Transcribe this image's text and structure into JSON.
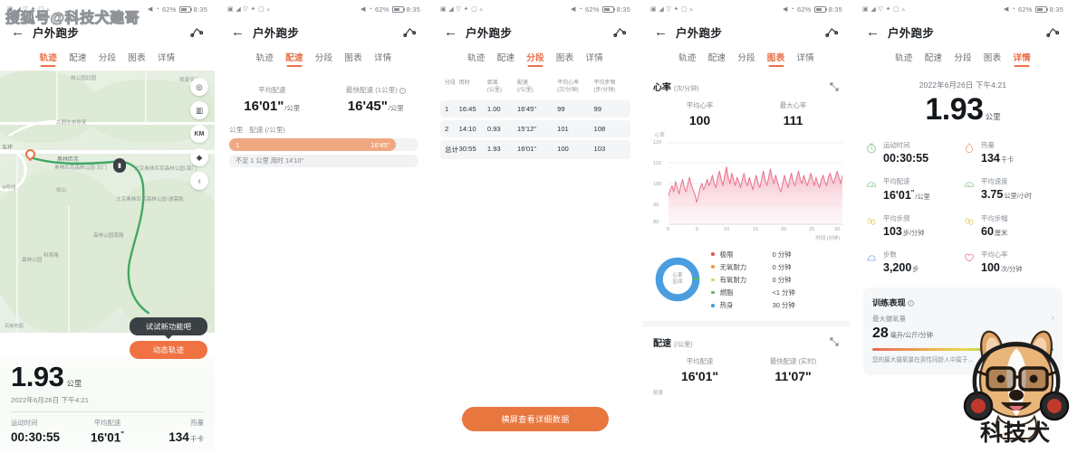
{
  "watermarks": {
    "sohu": "搜狐号@科技犬建哥",
    "mascot_label": "科技犬"
  },
  "status_bar": {
    "battery_percent": "62%",
    "time": "8:35",
    "icons": [
      "sim-icon",
      "signal-icon",
      "wifi-icon",
      "bluetooth-icon",
      "nfc-icon",
      "vpn-icon"
    ],
    "right_icons": [
      "mute-icon",
      "alarm-icon"
    ]
  },
  "nav": {
    "back_icon": "back-arrow-icon",
    "title": "户外跑步",
    "share_icon": "share-icon"
  },
  "tabs": [
    {
      "label": "轨迹"
    },
    {
      "label": "配速"
    },
    {
      "label": "分段"
    },
    {
      "label": "图表"
    },
    {
      "label": "详情"
    }
  ],
  "panel1": {
    "active_tab": "轨迹",
    "map": {
      "labels": [
        "林公园北园",
        "观景平台",
        "北园生态修复",
        "五环",
        "奥林匹克",
        "奥林匹克森林公园·北门",
        "北京奥林匹克森林公园·南门",
        "仰山",
        "北京奥林匹克森林公园·速需跑",
        "森林公园南路",
        "森林公园",
        "8号线",
        "科荟路",
        "百度地图"
      ],
      "controls": [
        "locate-icon",
        "map-layers-icon",
        "km-icon",
        "layers-stack-icon",
        "route-3d-icon"
      ],
      "start_marker": "start-marker",
      "end_marker": "end-marker"
    },
    "tip": {
      "bubble": "试试新功能吧",
      "button": "动态轨迹"
    },
    "summary": {
      "distance": "1.93",
      "distance_unit": "公里",
      "datetime": "2022年6月26日 下午4:21",
      "stats": [
        {
          "label": "运动时间",
          "value": "00:30:55",
          "unit": ""
        },
        {
          "label": "平均配速",
          "value": "16'01",
          "sup": "\"",
          "unit": ""
        },
        {
          "label": "热量",
          "value": "134",
          "unit": "千卡"
        }
      ]
    }
  },
  "panel2": {
    "active_tab": "配速",
    "avg_pace": {
      "label": "平均配速",
      "value": "16'01\"",
      "unit": "/公里"
    },
    "fastest_pace": {
      "label": "最快配速 (1公里)",
      "value": "16'45\"",
      "unit": "/公里",
      "info_icon": "info-icon"
    },
    "table_header": {
      "km": "公里",
      "pace": "配速 (/公里)"
    },
    "bars": [
      {
        "km": "1",
        "pace": "16'45\"",
        "fill_percent": 88
      }
    ],
    "note": "不足 1 公里 用时 14'10\""
  },
  "panel3": {
    "active_tab": "分段",
    "columns": [
      "分段",
      "用时",
      "距离\n(公里)",
      "配速\n(/公里)",
      "平均心率\n(次/分钟)",
      "平均步频\n(步/分钟)"
    ],
    "columns_flat": [
      {
        "l1": "分段",
        "l2": ""
      },
      {
        "l1": "用时",
        "l2": ""
      },
      {
        "l1": "距离",
        "l2": "(公里)"
      },
      {
        "l1": "配速",
        "l2": "(/公里)"
      },
      {
        "l1": "平均心率",
        "l2": "(次/分钟)"
      },
      {
        "l1": "平均步频",
        "l2": "(步/分钟)"
      }
    ],
    "rows": [
      {
        "seg": "1",
        "time": "16:45",
        "dist": "1.00",
        "pace": "16'45\"",
        "hr": "99",
        "cadence": "99"
      },
      {
        "seg": "2",
        "time": "14:10",
        "dist": "0.93",
        "pace": "15'12\"",
        "hr": "101",
        "cadence": "108"
      },
      {
        "seg": "总计",
        "time": "30:55",
        "dist": "1.93",
        "pace": "16'01\"",
        "hr": "100",
        "cadence": "103"
      }
    ],
    "button": "横屏查看详细数据"
  },
  "panel4": {
    "active_tab": "图表",
    "heart_rate": {
      "title": "心率",
      "unit": "(次/分钟)",
      "expand_icon": "expand-icon",
      "avg": {
        "label": "平均心率",
        "value": "100"
      },
      "max": {
        "label": "最大心率",
        "value": "111"
      }
    },
    "zones_legend": [
      {
        "name": "极限",
        "time": "0 分钟",
        "color": "#e8554e"
      },
      {
        "name": "无氧耐力",
        "time": "0 分钟",
        "color": "#ef9a3d"
      },
      {
        "name": "有氧耐力",
        "time": "0 分钟",
        "color": "#e3d14a"
      },
      {
        "name": "燃脂",
        "time": "<1 分钟",
        "color": "#5cb85c"
      },
      {
        "name": "热身",
        "time": "30 分钟",
        "color": "#4a9ee0"
      }
    ],
    "donut_label_line1": "心率",
    "donut_label_line2": "区间",
    "pace_section": {
      "title": "配速",
      "unit": "(/公里)",
      "expand_icon": "expand-icon",
      "avg": {
        "label": "平均配速",
        "value": "16'01\""
      },
      "fastest": {
        "label": "最快配速 (实时)",
        "value": "11'07\""
      },
      "axis_name": "配速"
    },
    "chart_data": {
      "type": "line",
      "title": "心率",
      "xlabel": "时间 (分钟)",
      "ylabel": "心率",
      "ylim": [
        80,
        120
      ],
      "xlim": [
        0,
        30
      ],
      "yticks": [
        80,
        90,
        100,
        110,
        120
      ],
      "xticks": [
        0,
        5,
        10,
        15,
        20,
        25,
        30
      ],
      "series": [
        {
          "name": "心率",
          "color": "#e8738c",
          "values": [
            94,
            97,
            99,
            96,
            101,
            98,
            95,
            99,
            102,
            98,
            96,
            100,
            103,
            99,
            97,
            95,
            91,
            94,
            98,
            100,
            97,
            99,
            102,
            99,
            101,
            104,
            100,
            98,
            103,
            106,
            102,
            99,
            104,
            108,
            103,
            100,
            105,
            102,
            99,
            103,
            101,
            98,
            102,
            105,
            101,
            99,
            103,
            100,
            97,
            101,
            104,
            100,
            98,
            102,
            106,
            102,
            99,
            103,
            107,
            103,
            100,
            104,
            101,
            98,
            96,
            100,
            104,
            101,
            98,
            102,
            105,
            101,
            99,
            103,
            106,
            102,
            100,
            104,
            101,
            99,
            102,
            105,
            102,
            99,
            103,
            100,
            98,
            102,
            104,
            101,
            99,
            103,
            105,
            102,
            100,
            103,
            106,
            103,
            100,
            104
          ]
        }
      ],
      "grid": true,
      "legend": "none"
    }
  },
  "panel5": {
    "active_tab": "详情",
    "datetime": "2022年6月26日 下午4:21",
    "distance": "1.93",
    "distance_unit": "公里",
    "metrics": [
      {
        "icon": "stopwatch-icon",
        "label": "运动时间",
        "value": "00:30:55",
        "unit": "",
        "color": "#8fc69a"
      },
      {
        "icon": "flame-icon",
        "label": "热量",
        "value": "134",
        "unit": "千卡",
        "color": "#efa87f"
      },
      {
        "icon": "speedometer-icon",
        "label": "平均配速",
        "value": "16'01",
        "sup": "\"",
        "unit": "/公里",
        "color": "#9ad0a2"
      },
      {
        "icon": "gauge-icon",
        "label": "平均速度",
        "value": "3.75",
        "unit": "公里/小时",
        "color": "#9ad0a2"
      },
      {
        "icon": "footsteps-icon",
        "label": "平均步频",
        "value": "103",
        "unit": "步/分钟",
        "color": "#e2cf78"
      },
      {
        "icon": "stride-icon",
        "label": "平均步幅",
        "value": "60",
        "unit": "厘米",
        "color": "#e2cf78"
      },
      {
        "icon": "shoe-icon",
        "label": "步数",
        "value": "3,200",
        "unit": "步",
        "color": "#8fb6e0"
      },
      {
        "icon": "heart-icon",
        "label": "平均心率",
        "value": "100",
        "unit": "次/分钟",
        "color": "#e48aa0"
      }
    ],
    "training": {
      "title": "训练表现",
      "info_icon": "info-icon",
      "metric_label": "最大摄氧量",
      "value": "28",
      "unit": "毫升/公斤/分钟",
      "note": "您的最大摄氧量在男性同龄人中属于...",
      "chevron_icon": "chevron-right-icon"
    }
  },
  "colors": {
    "accent": "#e8714a",
    "accent_button": "#e8763f",
    "heart_rate": "#e8738c",
    "map_track": "#3fa863"
  }
}
